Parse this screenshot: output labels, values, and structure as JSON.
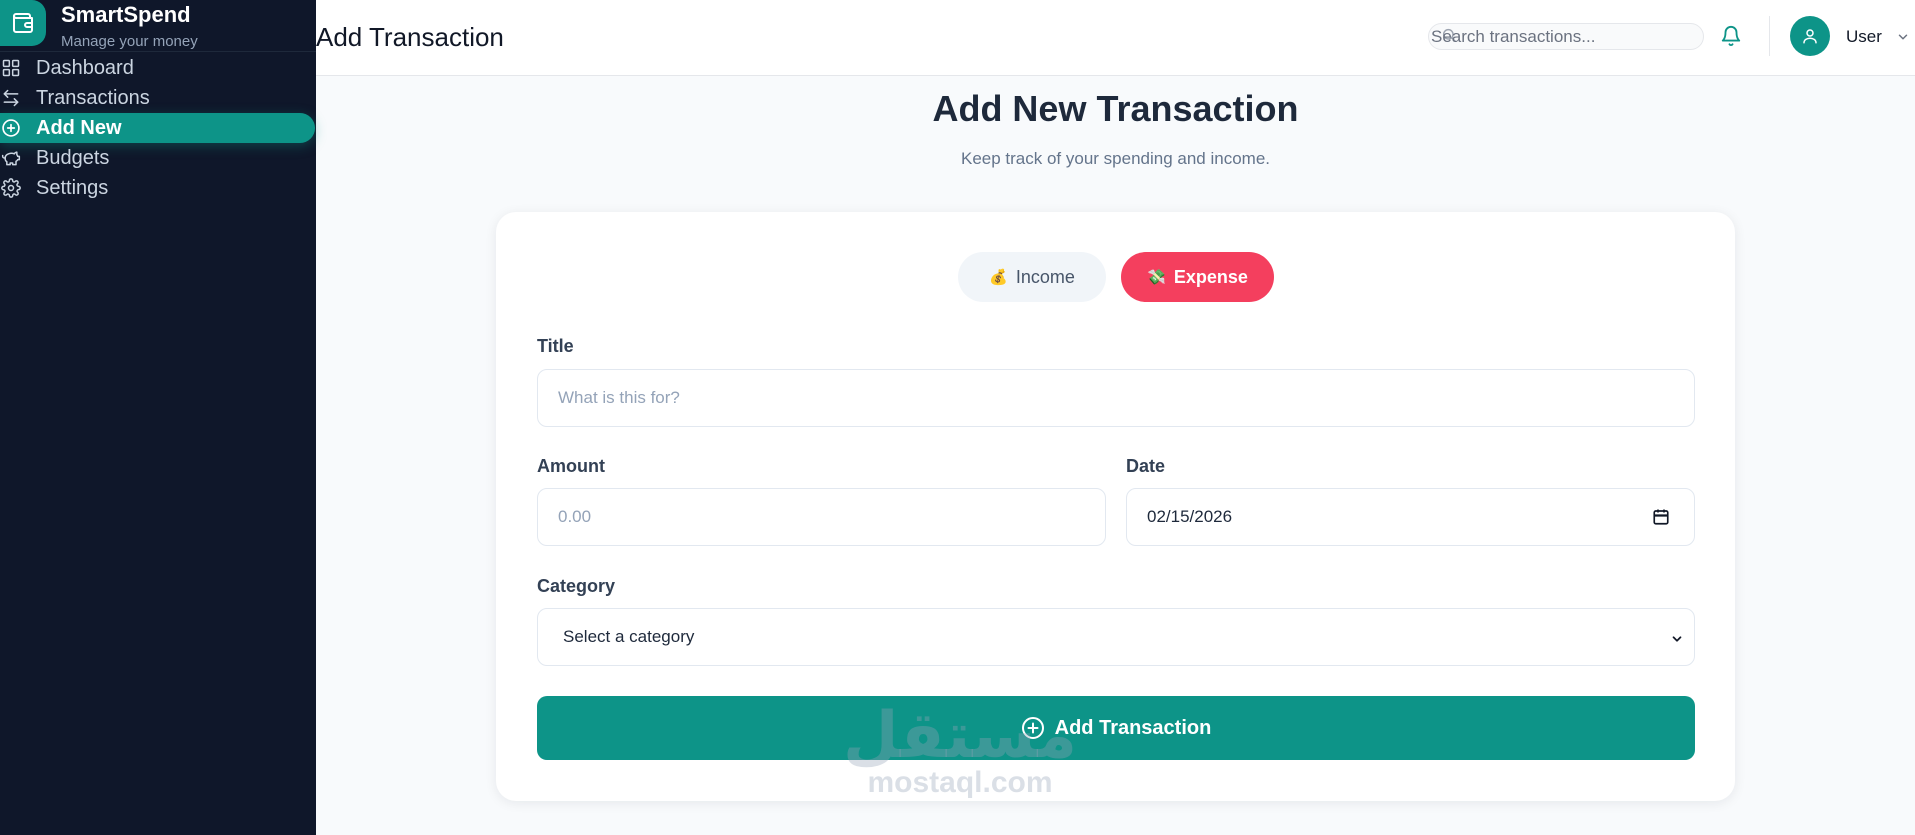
{
  "app": {
    "name": "SmartSpend",
    "tagline": "Manage your money"
  },
  "sidebar": {
    "items": [
      {
        "label": "Dashboard",
        "icon": "grid-icon",
        "active": false
      },
      {
        "label": "Transactions",
        "icon": "arrows-left-right-icon",
        "active": false
      },
      {
        "label": "Add New",
        "icon": "plus-circle-icon",
        "active": true
      },
      {
        "label": "Budgets",
        "icon": "piggy-bank-icon",
        "active": false
      },
      {
        "label": "Settings",
        "icon": "gear-icon",
        "active": false
      }
    ]
  },
  "header": {
    "title": "Add Transaction",
    "search_placeholder": "Search transactions...",
    "user_name": "User"
  },
  "main": {
    "title": "Add New Transaction",
    "subtitle": "Keep track of your spending and income."
  },
  "form": {
    "type_toggle": {
      "income_label": "Income",
      "income_emoji": "💰",
      "expense_label": "Expense",
      "expense_emoji": "💸",
      "selected": "Expense"
    },
    "title_label": "Title",
    "title_placeholder": "What is this for?",
    "amount_label": "Amount",
    "amount_placeholder": "0.00",
    "date_label": "Date",
    "date_value": "02/15/2026",
    "category_label": "Category",
    "category_selected": "Select a category",
    "submit_label": "Add Transaction"
  },
  "watermark": {
    "arabic": "مستقل",
    "latin": "mostaql.com"
  },
  "colors": {
    "accent": "#0d9488",
    "sidebar_bg": "#0f172a",
    "expense": "#f43f5e",
    "page_bg": "#f8fafc"
  }
}
